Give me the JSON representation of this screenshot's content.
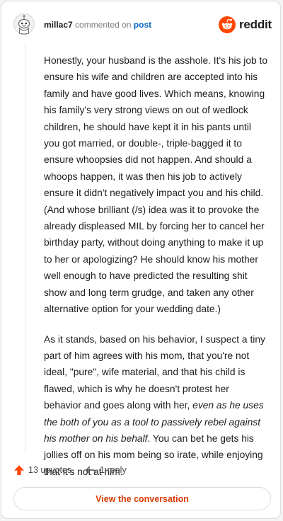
{
  "header": {
    "username": "millac7",
    "action_text": "commented on",
    "post_link": "post",
    "brand": "reddit"
  },
  "comment": {
    "p1": "Honestly, your husband is the asshole. It's his job to ensure his wife and children are accepted into his family and have good lives. Which means, knowing his family's very strong views on out of wedlock children, he should have kept it in his pants until you got married, or double-, triple-bagged it to ensure whoopsies did not happen. And should a whoops happen, it was then his job to actively ensure it didn't negatively impact you and his child. (And whose brilliant (/s) idea was it to provoke the already displeased MIL by forcing her to cancel her birthday party, without doing anything to make it up to her or apologizing? He should know his mother well enough to have predicted the resulting shit show and long term grudge, and taken any other alternative option for your wedding date.)",
    "p2_start": "As it stands, based on his behavior, I suspect a tiny part of him agrees with his mom, that you're not ideal, \"pure\", wife material, and that his child is flawed, which is why he doesn't protest her behavior and goes along with her, ",
    "p2_italic": "even as he uses the both of you as a tool to passively rebel against his mother on his behalf",
    "p2_end": ". You can bet he gets his jollies off on his mom being so irate, while enjoying that it's not at him."
  },
  "actions": {
    "upvotes": "13 upvotes",
    "reply": "1 reply"
  },
  "footer": {
    "view_label": "View the conversation"
  },
  "icons": {
    "upvote": "upvote-arrow-icon",
    "reply": "reply-arrow-icon",
    "avatar": "snoo-avatar-icon",
    "brand": "reddit-logo-icon"
  },
  "colors": {
    "accent": "#ff4500",
    "link": "#0b66c3",
    "view_label": "#d93a00"
  }
}
